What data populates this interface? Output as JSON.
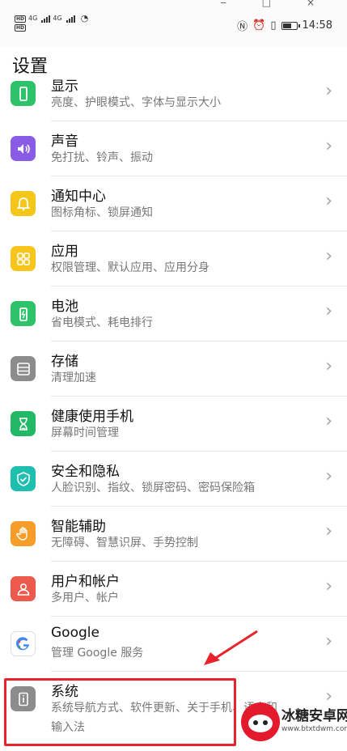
{
  "status": {
    "left_row1": "HD 4G",
    "left_row2": "HD",
    "time": "14:58",
    "right_icons": [
      "nfc-icon",
      "alarm-icon",
      "vibrate-icon",
      "battery-icon"
    ]
  },
  "page": {
    "title": "设置"
  },
  "items": [
    {
      "title": "显示",
      "subtitle": "亮度、护眼模式、字体与显示大小",
      "icon": "display-icon",
      "color": "#2ec36b"
    },
    {
      "title": "声音",
      "subtitle": "免打扰、铃声、振动",
      "icon": "sound-icon",
      "color": "#8a5ce6"
    },
    {
      "title": "通知中心",
      "subtitle": "图标角标、锁屏通知",
      "icon": "bell-icon",
      "color": "#f5c61a"
    },
    {
      "title": "应用",
      "subtitle": "权限管理、默认应用、应用分身",
      "icon": "apps-icon",
      "color": "#f7c51c"
    },
    {
      "title": "电池",
      "subtitle": "省电模式、耗电排行",
      "icon": "battery-icon",
      "color": "#2ec36b"
    },
    {
      "title": "存储",
      "subtitle": "清理加速",
      "icon": "storage-icon",
      "color": "#8c8c8c"
    },
    {
      "title": "健康使用手机",
      "subtitle": "屏幕时间管理",
      "icon": "hourglass-icon",
      "color": "#22b866"
    },
    {
      "title": "安全和隐私",
      "subtitle": "人脸识别、指纹、锁屏密码、密码保险箱",
      "icon": "shield-icon",
      "color": "#1fbfb0"
    },
    {
      "title": "智能辅助",
      "subtitle": "无障碍、智慧识屏、手势控制",
      "icon": "hand-icon",
      "color": "#f59d28"
    },
    {
      "title": "用户和帐户",
      "subtitle": "多用户、帐户",
      "icon": "user-icon",
      "color": "#ec5a4d"
    },
    {
      "title": "Google",
      "subtitle": "管理 Google 服务",
      "icon": "google-icon",
      "color": "#4285f4"
    },
    {
      "title": "系统",
      "subtitle": "系统导航方式、软件更新、关于手机、语言和",
      "subtitle2": "输入法",
      "icon": "system-icon",
      "color": "#8c8c8c"
    }
  ],
  "watermark": {
    "name": "冰糖安卓网",
    "url": "www.btxtdwm.com"
  },
  "colors": {
    "annotation": "#e8232b",
    "chevron": "#a6a6a6"
  }
}
